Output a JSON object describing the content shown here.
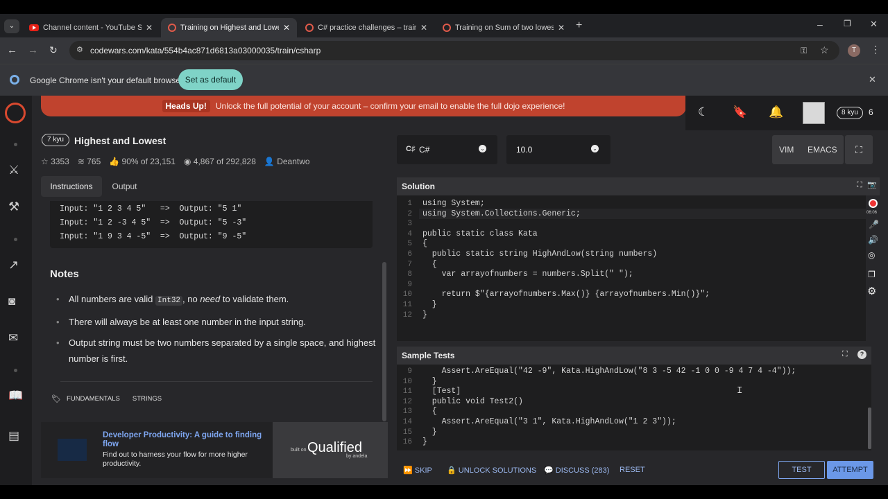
{
  "browser": {
    "tabs": [
      {
        "title": "Channel content - YouTube Stu",
        "icon": "youtube-icon",
        "active": false
      },
      {
        "title": "Training on Highest and Lowest",
        "icon": "codewars-icon",
        "active": true
      },
      {
        "title": "C# practice challenges – train o",
        "icon": "codewars-icon",
        "active": false
      },
      {
        "title": "Training on Sum of two lowest p",
        "icon": "codewars-icon",
        "active": false
      }
    ],
    "url": "codewars.com/kata/554b4ac871d6813a03000035/train/csharp",
    "profile_initial": "T",
    "infobar_text": "Google Chrome isn't your default browser",
    "infobar_button": "Set as default"
  },
  "banner": {
    "bold": "Heads Up!",
    "text": "Unlock the full potential of your account – confirm your email to enable the full dojo experience!"
  },
  "user": {
    "rank": "8 kyu",
    "honor": "6"
  },
  "kata": {
    "rank": "7 kyu",
    "title": "Highest and Lowest",
    "stars": "3353",
    "collections": "765",
    "satisfaction": "90%",
    "satisfaction_of": "of 23,151",
    "completed": "4,867",
    "completed_of": "of 292,828",
    "author": "Deantwo"
  },
  "left_tabs": [
    "Instructions",
    "Output"
  ],
  "examples": [
    "Input: \"1 2 3 4 5\"   =>  Output: \"5 1\"",
    "Input: \"1 2 -3 4 5\"  =>  Output: \"5 -3\"",
    "Input: \"1 9 3 4 -5\"  =>  Output: \"9 -5\""
  ],
  "notes": {
    "heading": "Notes",
    "item1_pre": "All numbers are valid",
    "item1_code": "Int32",
    "item1_mid": ", no",
    "item1_em": "need",
    "item1_post": "to validate them.",
    "item2": "There will always be at least one number in the input string.",
    "item3": "Output string must be two numbers separated by a single space, and highest number is first."
  },
  "tags": [
    "FUNDAMENTALS",
    "STRINGS"
  ],
  "ad": {
    "title": "Developer Productivity: A guide to finding flow",
    "text": "Find out to harness your flow for more higher productivity.",
    "built_on": "built on",
    "brand": "Qualified",
    "by": "by andela"
  },
  "editor": {
    "language": "C#",
    "version": "10.0",
    "modes": [
      "VIM",
      "EMACS"
    ],
    "solution_title": "Solution",
    "solution_lines": [
      {
        "n": "1",
        "code": "using System;"
      },
      {
        "n": "2",
        "code": "using System.Collections.Generic;"
      },
      {
        "n": "3",
        "code": ""
      },
      {
        "n": "4",
        "code": "public static class Kata"
      },
      {
        "n": "5",
        "code": "{"
      },
      {
        "n": "6",
        "code": "  public static string HighAndLow(string numbers)"
      },
      {
        "n": "7",
        "code": "  {"
      },
      {
        "n": "8",
        "code": "    var arrayofnumbers = numbers.Split(\" \");"
      },
      {
        "n": "9",
        "code": ""
      },
      {
        "n": "10",
        "code": "    return $\"{arrayofnumbers.Max()} {arrayofnumbers.Min()}\";"
      },
      {
        "n": "11",
        "code": "  }"
      },
      {
        "n": "12",
        "code": "}"
      }
    ],
    "record_time": "06:06",
    "tests_title": "Sample Tests",
    "test_lines": [
      {
        "n": "9",
        "code": "    Assert.AreEqual(\"42 -9\", Kata.HighAndLow(\"8 3 -5 42 -1 0 0 -9 4 7 4 -4\"));"
      },
      {
        "n": "10",
        "code": "  }"
      },
      {
        "n": "11",
        "code": "  [Test]"
      },
      {
        "n": "12",
        "code": "  public void Test2()"
      },
      {
        "n": "13",
        "code": "  {"
      },
      {
        "n": "14",
        "code": "    Assert.AreEqual(\"3 1\", Kata.HighAndLow(\"1 2 3\"));"
      },
      {
        "n": "15",
        "code": "  }"
      },
      {
        "n": "16",
        "code": "}"
      }
    ]
  },
  "actions": {
    "skip": "SKIP",
    "unlock": "UNLOCK SOLUTIONS",
    "discuss": "DISCUSS (283)",
    "reset": "RESET",
    "test": "TEST",
    "attempt": "ATTEMPT"
  },
  "colors": {
    "accent": "#d9492f",
    "banner": "#c0432e",
    "button_teal": "#7fd3c7",
    "attempt": "#6b98e8",
    "link": "#7ea6f0"
  }
}
